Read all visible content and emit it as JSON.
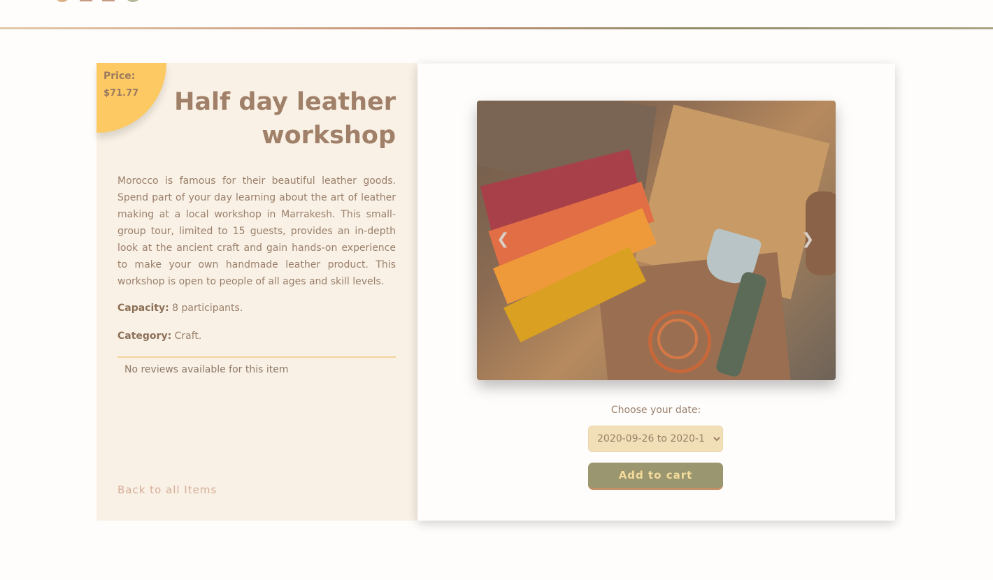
{
  "product": {
    "title": "Half day leather workshop",
    "price_label": "Price:",
    "price_value": "$71.77",
    "description": "Morocco is famous for their beautiful leather goods. Spend part of your day learning about the art of leather making at a local workshop in Marrakesh. This small-group tour, limited to 15 guests, provides an in-depth look at the ancient craft and gain hands-on experience to make your own handmade leather product. This workshop is open to people of all ages and skill levels.",
    "capacity_label": "Capacity:",
    "capacity_value": "8 participants.",
    "category_label": "Category:",
    "category_value": "Craft.",
    "reviews_text": "No reviews available for this item",
    "back_link": "Back to all Items"
  },
  "booking": {
    "date_label": "Choose your date:",
    "date_selected": "2020-09-26 to 2020-1",
    "add_to_cart": "Add to cart"
  },
  "carousel": {
    "prev_icon": "chevron-left-icon",
    "next_icon": "chevron-right-icon"
  },
  "colors": {
    "badge": "#fcc963",
    "button": "#9a9670",
    "select_bg": "#f1e0b7"
  }
}
